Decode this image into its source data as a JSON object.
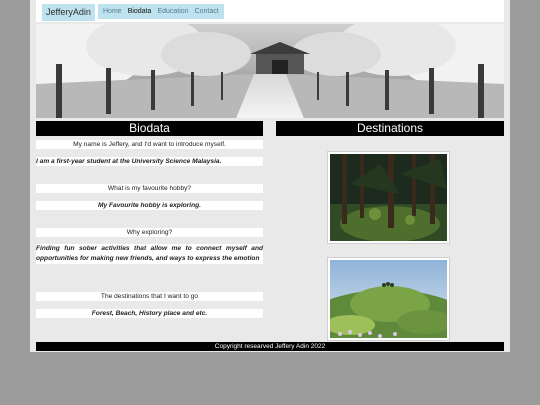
{
  "nav": {
    "brand": "JefferyAdin",
    "links": [
      "Home",
      "Biodata",
      "Education",
      "Contact"
    ],
    "active": "Biodata"
  },
  "biodata": {
    "title": "Biodata",
    "intro": "My name is Jeffery, and I'd want to introduce myself.",
    "student": "I am a first-year student at the University Science Malaysia.",
    "q_hobby": "What is my favourite hobby?",
    "a_hobby": "My Favourite hobby is exploring",
    "q_why": "Why exploring?",
    "a_why": "Finding fun sober activities that allow me to connect myself and opportunities for making new friends, and ways to express the emotion",
    "q_dest": "The destinations that I want to go",
    "a_dest": "Forest, Beach, History place and etc."
  },
  "destinations": {
    "title": "Destinations",
    "images": [
      "forest-photo",
      "hill-landscape-photo"
    ]
  },
  "footer": {
    "text": "Copyright researved Jeffery Adin 2022"
  }
}
